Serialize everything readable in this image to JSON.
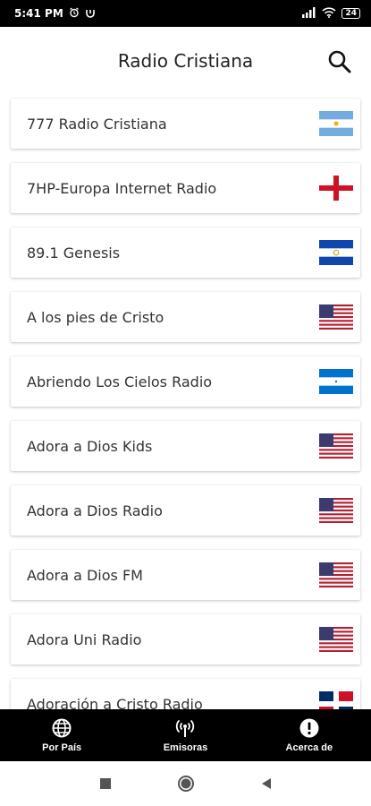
{
  "status_bar": {
    "time": "5:41 PM",
    "battery": "24"
  },
  "header": {
    "title": "Radio Cristiana"
  },
  "stations": [
    {
      "name": "777 Radio Cristiana",
      "flag": "argentina-flag"
    },
    {
      "name": "7HP-Europa Internet Radio",
      "flag": "england-flag"
    },
    {
      "name": "89.1 Genesis",
      "flag": "el-salvador-flag"
    },
    {
      "name": "A los pies de Cristo",
      "flag": "usa-flag"
    },
    {
      "name": "Abriendo Los Cielos Radio",
      "flag": "honduras-flag"
    },
    {
      "name": "Adora a Dios Kids",
      "flag": "usa-flag"
    },
    {
      "name": "Adora a Dios Radio",
      "flag": "usa-flag"
    },
    {
      "name": "Adora a Dios FM",
      "flag": "usa-flag"
    },
    {
      "name": "Adora Uni Radio",
      "flag": "usa-flag"
    },
    {
      "name": "Adoración a Cristo Radio",
      "flag": "dominican-republic-flag"
    }
  ],
  "bottom_nav": [
    {
      "label": "Por País",
      "icon": "globe-icon"
    },
    {
      "label": "Emisoras",
      "icon": "broadcast-icon"
    },
    {
      "label": "Acerca de",
      "icon": "info-icon"
    }
  ]
}
